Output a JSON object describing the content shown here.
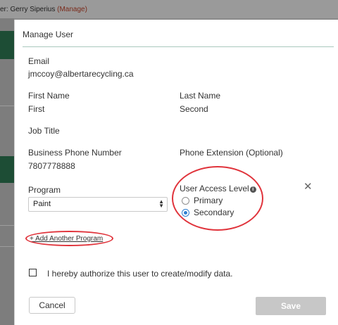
{
  "background": {
    "user_prefix": "er: Gerry Siperius",
    "manage_link": "(Manage)"
  },
  "modal": {
    "title": "Manage User",
    "email_label": "Email",
    "email_value": "jmccoy@albertarecycling.ca",
    "first_name_label": "First Name",
    "first_name_value": "First",
    "last_name_label": "Last Name",
    "last_name_value": "Second",
    "job_title_label": "Job Title",
    "business_phone_label": "Business Phone Number",
    "business_phone_value": "7807778888",
    "phone_ext_label": "Phone Extension (Optional)",
    "program_label": "Program",
    "program_selected": "Paint",
    "access_level_label": "User Access Level",
    "access_options": [
      "Primary",
      "Secondary"
    ],
    "access_selected": "Secondary",
    "add_program_link": "+ Add Another Program",
    "authorize_label": "I hereby authorize this user to create/modify data.",
    "authorize_checked": false,
    "cancel_label": "Cancel",
    "save_label": "Save"
  },
  "colors": {
    "annotation": "#e0333b",
    "radio_selected": "#2f7fd0",
    "save_disabled": "#c7c7c7",
    "title_rule": "#a9c9bd"
  }
}
